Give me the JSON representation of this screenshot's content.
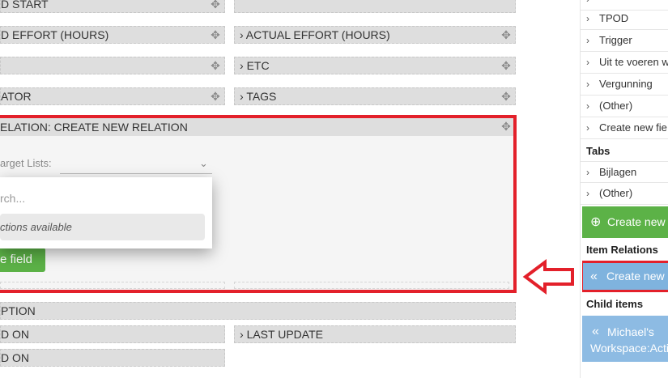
{
  "fields": {
    "row0_left": "D START",
    "row1_left": "D EFFORT (HOURS)",
    "row1_right": "ACTUAL EFFORT (HOURS)",
    "row2_right": "ETC",
    "row3_left": "ATOR",
    "row3_right": "TAGS",
    "row5_left": "PTION",
    "row6_left": "D ON",
    "row6_right": "LAST UPDATE",
    "row7_left": "D ON"
  },
  "relation": {
    "title": "ELATION: CREATE NEW RELATION",
    "target_label": "arget Lists:",
    "search_placeholder": "rch...",
    "no_options": "ctions available",
    "add_field_button": "e field"
  },
  "sidebar": {
    "items_top": [
      {
        "label": "TPOD"
      },
      {
        "label": "Trigger"
      },
      {
        "label": "Uit te voeren w"
      },
      {
        "label": "Vergunning"
      },
      {
        "label": "(Other)"
      },
      {
        "label": "Create new fie"
      }
    ],
    "tabs_heading": "Tabs",
    "tabs": [
      {
        "label": "Bijlagen"
      },
      {
        "label": "(Other)"
      }
    ],
    "create_new_green": "Create new",
    "item_relations_heading": "Item Relations",
    "create_new_blue": "Create new",
    "child_items_heading": "Child items",
    "child_item_line1": "Michael's",
    "child_item_line2": "Workspace:Acti"
  },
  "glyphs": {
    "chevron_right": "›",
    "move": "✥",
    "double_left": "«",
    "plus_circle": "⊕",
    "chevron_down": "⌄"
  }
}
